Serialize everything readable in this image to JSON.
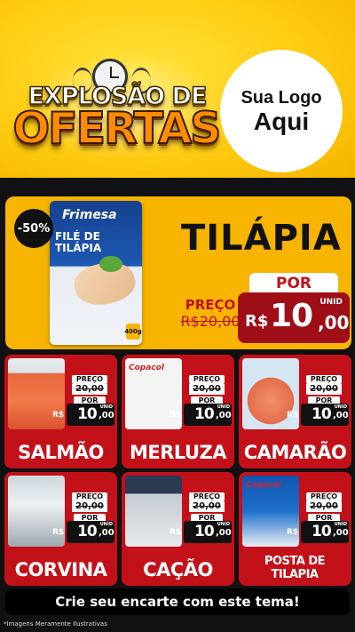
{
  "header": {
    "headline_line1": "EXPLOSÃO DE",
    "headline_line2": "OFERTAS",
    "logo_line1": "Sua Logo",
    "logo_line2": "Aqui"
  },
  "featured": {
    "discount": "-50%",
    "package_brand": "Frimesa",
    "package_title": "FILÉ DE TILÁPIA",
    "package_weight": "400g",
    "name": "TILÁPIA",
    "old_price_label": "PREÇO",
    "old_price": "20,00",
    "new_price_label": "POR",
    "unit": "UNID",
    "currency": "R$",
    "price_int": "10",
    "price_cents": ",00"
  },
  "products": [
    {
      "name": "SALMÃO",
      "brand": "",
      "preco_label": "PREÇO",
      "old_price": "20,00",
      "por_label": "POR",
      "unit": "UNID",
      "currency": "R$",
      "price_int": "10",
      "price_cents": ",00"
    },
    {
      "name": "MERLUZA",
      "brand": "Copacol",
      "preco_label": "PREÇO",
      "old_price": "20,00",
      "por_label": "POR",
      "unit": "UNID",
      "currency": "R$",
      "price_int": "10",
      "price_cents": ",00"
    },
    {
      "name": "CAMARÃO",
      "brand": "",
      "preco_label": "PREÇO",
      "old_price": "20,00",
      "por_label": "POR",
      "unit": "UNID",
      "currency": "R$",
      "price_int": "10",
      "price_cents": ",00"
    },
    {
      "name": "CORVINA",
      "brand": "",
      "preco_label": "PREÇO",
      "old_price": "20,00",
      "por_label": "POR",
      "unit": "UNID",
      "currency": "R$",
      "price_int": "10",
      "price_cents": ",00"
    },
    {
      "name": "CAÇÃO",
      "brand": "",
      "preco_label": "PREÇO",
      "old_price": "20,00",
      "por_label": "POR",
      "unit": "UNID",
      "currency": "R$",
      "price_int": "10",
      "price_cents": ",00"
    },
    {
      "name": "POSTA DE TILAPIA",
      "brand": "Copacol",
      "preco_label": "PREÇO",
      "old_price": "20,00",
      "por_label": "POR",
      "unit": "UNID",
      "currency": "R$",
      "price_int": "10",
      "price_cents": ",00"
    }
  ],
  "cta": "Crie seu encarte com este tema!",
  "footnote": "*Imagens Meramente Ilustrativas",
  "colors": {
    "header_yellow": "#ffcc12",
    "card_red": "#c3111a",
    "price_dark_red": "#9f0e16",
    "featured_yellow": "#f7b400",
    "background": "#111111"
  }
}
